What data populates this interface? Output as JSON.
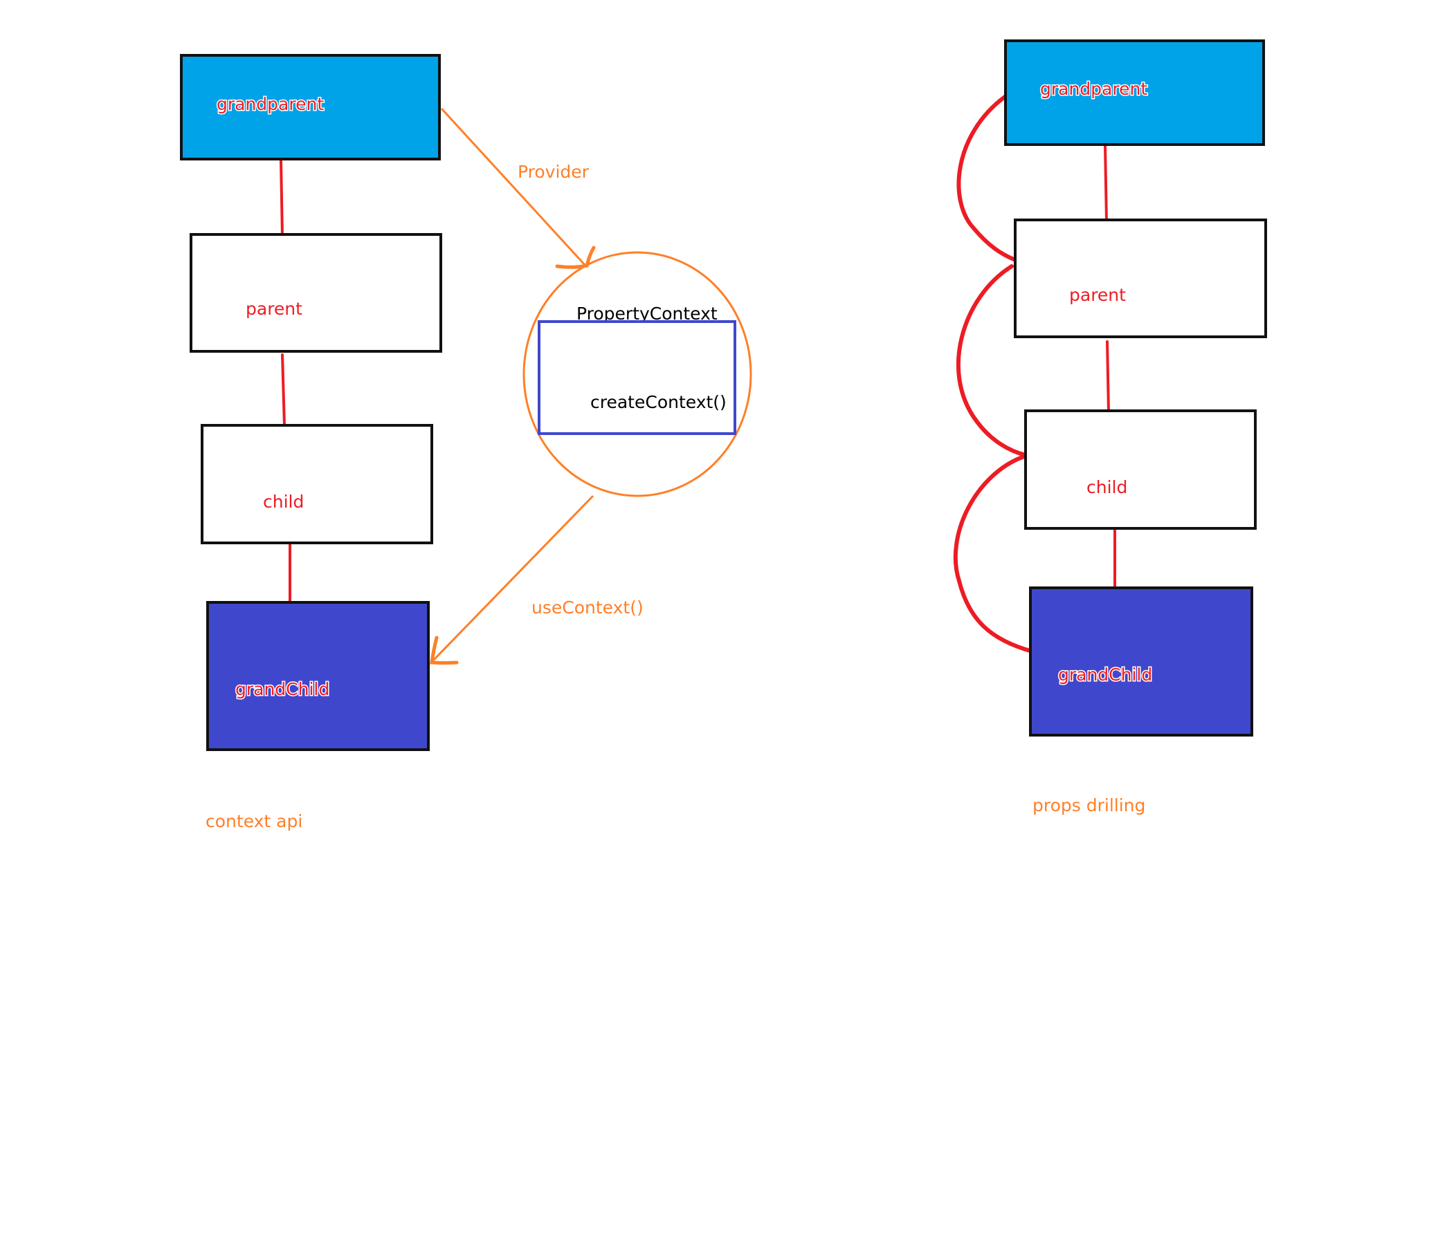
{
  "colors": {
    "background": "#ffffff",
    "box_border": "#111111",
    "grandparent_fill": "#00a2e8",
    "grandchild_fill": "#3f48cc",
    "node_text": "#ed1c24",
    "red_line": "#ed1c24",
    "orange": "#ff7f27",
    "context_box_border": "#3f48cc",
    "context_text": "#000000"
  },
  "icons": {
    "provider_arrow": "arrow-icon",
    "usecontext_arrow": "arrow-icon"
  },
  "context_api": {
    "nodes": {
      "grandparent": "grandparent",
      "parent": "parent",
      "child": "child",
      "grandchild": "grandChild"
    },
    "provider_label": "Provider",
    "context_label": "PropertyContext",
    "create_context_label": "createContext()",
    "use_context_label": "useContext()",
    "caption": "context api"
  },
  "props_drilling": {
    "nodes": {
      "grandparent": "grandparent",
      "parent": "parent",
      "child": "child",
      "grandchild": "grandChild"
    },
    "caption": "props drilling"
  }
}
